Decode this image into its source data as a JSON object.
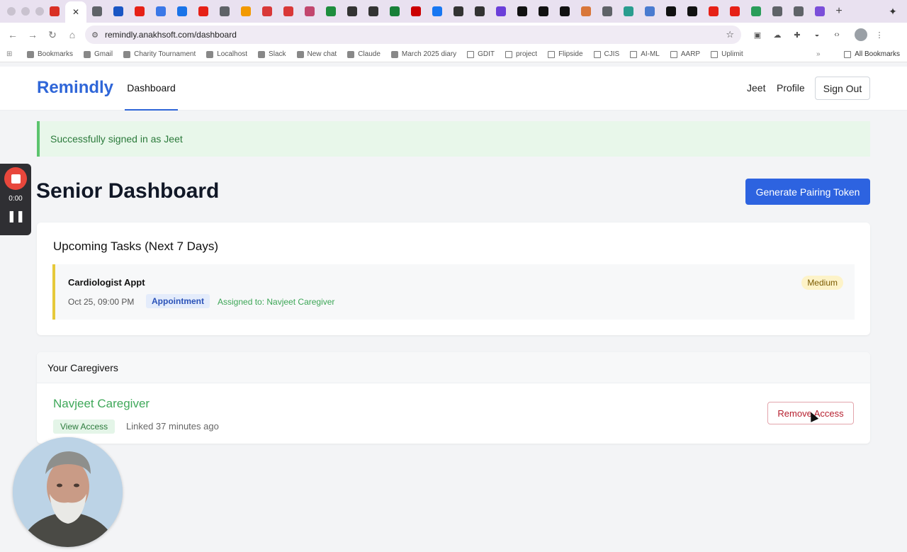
{
  "browser": {
    "url": "remindly.anakhsoft.com/dashboard",
    "tabs": [
      {
        "icon": "gmail-icon",
        "color": "#d93025"
      },
      {
        "icon": "close-icon",
        "color": "#333333"
      },
      {
        "icon": "globe-icon",
        "color": "#5f6368"
      },
      {
        "icon": "paypal-icon",
        "color": "#1a56c4"
      },
      {
        "icon": "youtube-icon",
        "color": "#e62117"
      },
      {
        "icon": "docs-icon",
        "color": "#3b78e7"
      },
      {
        "icon": "circle-icon",
        "color": "#1a73e8"
      },
      {
        "icon": "youtube-icon",
        "color": "#e62117"
      },
      {
        "icon": "globe-icon",
        "color": "#5f6368"
      },
      {
        "icon": "slides-icon",
        "color": "#f29900"
      },
      {
        "icon": "app-icon",
        "color": "#d93838"
      },
      {
        "icon": "app-icon",
        "color": "#d93838"
      },
      {
        "icon": "app-icon",
        "color": "#c2466e"
      },
      {
        "icon": "drive-icon",
        "color": "#1e8e3e"
      },
      {
        "icon": "openai-icon",
        "color": "#333333"
      },
      {
        "icon": "openai-icon",
        "color": "#333333"
      },
      {
        "icon": "sheets-icon",
        "color": "#188038"
      },
      {
        "icon": "cnn-icon",
        "color": "#cc0000"
      },
      {
        "icon": "facebook-icon",
        "color": "#1877f2"
      },
      {
        "icon": "app-icon",
        "color": "#333333"
      },
      {
        "icon": "app-icon",
        "color": "#333333"
      },
      {
        "icon": "app-icon",
        "color": "#6b3fd9"
      },
      {
        "icon": "triangle-icon",
        "color": "#111111"
      },
      {
        "icon": "triangle-icon",
        "color": "#111111"
      },
      {
        "icon": "github-icon",
        "color": "#111111"
      },
      {
        "icon": "claude-icon",
        "color": "#d9773a"
      },
      {
        "icon": "globe-icon",
        "color": "#5f6368"
      },
      {
        "icon": "app-icon",
        "color": "#2a9d8f"
      },
      {
        "icon": "app-icon",
        "color": "#4a7bd0"
      },
      {
        "icon": "app-icon",
        "color": "#111111"
      },
      {
        "icon": "github-icon",
        "color": "#111111"
      },
      {
        "icon": "youtube-icon",
        "color": "#e62117"
      },
      {
        "icon": "youtube-icon",
        "color": "#e62117"
      },
      {
        "icon": "app-icon",
        "color": "#2a9d5a"
      },
      {
        "icon": "globe-icon",
        "color": "#5f6368"
      },
      {
        "icon": "globe-icon",
        "color": "#5f6368"
      },
      {
        "icon": "app-icon",
        "color": "#7b4fd9"
      }
    ],
    "bookmarks": [
      {
        "label": "Bookmarks",
        "icon": "star-icon"
      },
      {
        "label": "Gmail",
        "icon": "gmail-icon"
      },
      {
        "label": "Charity Tournament",
        "icon": "triangle-icon"
      },
      {
        "label": "Localhost",
        "icon": "triangle-icon"
      },
      {
        "label": "Slack",
        "icon": "slack-icon"
      },
      {
        "label": "New chat",
        "icon": "openai-icon"
      },
      {
        "label": "Claude",
        "icon": "claude-icon"
      },
      {
        "label": "March 2025 diary",
        "icon": "github-icon"
      },
      {
        "label": "GDIT",
        "icon": "folder-icon"
      },
      {
        "label": "project",
        "icon": "folder-icon"
      },
      {
        "label": "Flipside",
        "icon": "folder-icon"
      },
      {
        "label": "CJIS",
        "icon": "folder-icon"
      },
      {
        "label": "AI-ML",
        "icon": "folder-icon"
      },
      {
        "label": "AARP",
        "icon": "folder-icon"
      },
      {
        "label": "Uplimit",
        "icon": "folder-icon"
      }
    ],
    "all_bookmarks": "All Bookmarks"
  },
  "app": {
    "brand": "Remindly",
    "nav_dashboard": "Dashboard",
    "user_name": "Jeet",
    "profile": "Profile",
    "sign_out": "Sign Out",
    "alert": "Successfully signed in as Jeet",
    "page_title": "Senior Dashboard",
    "generate_button": "Generate Pairing Token",
    "upcoming": {
      "title": "Upcoming Tasks (Next 7 Days)",
      "tasks": [
        {
          "name": "Cardiologist Appt",
          "date": "Oct 25, 09:00 PM",
          "category": "Appointment",
          "assigned": "Assigned to: Navjeet Caregiver",
          "priority": "Medium"
        }
      ]
    },
    "caregivers": {
      "title": "Your Caregivers",
      "items": [
        {
          "name": "Navjeet Caregiver",
          "access": "View Access",
          "linked": "Linked 37 minutes ago",
          "remove": "Remove Access"
        }
      ]
    }
  },
  "recorder": {
    "time": "0:00"
  }
}
